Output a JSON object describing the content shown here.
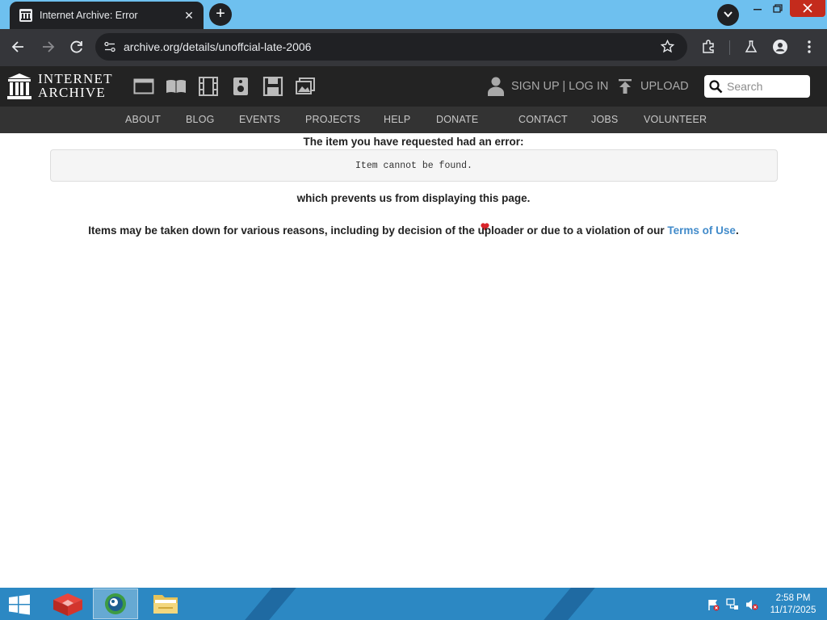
{
  "browser": {
    "tab_title": "Internet Archive: Error",
    "url": "archive.org/details/unoffcial-late-2006"
  },
  "site": {
    "logo_line1": "INTERNET",
    "logo_line2": "ARCHIVE",
    "media_icons": [
      "web-icon",
      "texts-icon",
      "video-icon",
      "audio-icon",
      "software-icon",
      "images-icon"
    ],
    "signup_label": "SIGN UP | LOG IN",
    "upload_label": "UPLOAD",
    "search_placeholder": "Search",
    "nav": [
      "ABOUT",
      "BLOG",
      "EVENTS",
      "PROJECTS",
      "HELP",
      "DONATE",
      "CONTACT",
      "JOBS",
      "VOLUNTEER"
    ],
    "donate_heart_color": "#d9242a"
  },
  "error": {
    "heading": "The item you have requested had an error:",
    "message": "Item cannot be found.",
    "prevent": "which prevents us from displaying this page.",
    "reason_prefix": "Items may be taken down for various reasons, including by decision of the uploader or due to a violation of our",
    "terms_link": "Terms of Use",
    "reason_suffix": "."
  },
  "taskbar": {
    "time": "2:58 PM",
    "date": "11/17/2025"
  },
  "colors": {
    "tabstrip": "#6ec0ef",
    "ia_header": "#232323",
    "ia_nav": "#333333",
    "link": "#428bca",
    "taskbar": "#2c88c3"
  }
}
